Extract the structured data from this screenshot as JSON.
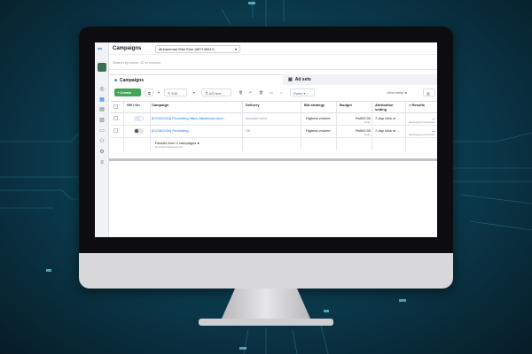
{
  "header": {
    "title": "Campaigns",
    "account": "Muhammad Bilal Sher (587145513...",
    "search_placeholder": "Search by name, ID or metrics"
  },
  "tabs": [
    {
      "label": "Campaigns",
      "icon": "folder-icon"
    },
    {
      "label": "Ad sets",
      "icon": "grid-icon"
    }
  ],
  "toolbar": {
    "create_label": "+ Create",
    "edit_label": "Edit",
    "abtest_label": "A/B test",
    "rules_label": "Rules",
    "view_setup_label": "View setup"
  },
  "table": {
    "columns": [
      "Off / On",
      "Campaign",
      "Delivery",
      "Bid strategy",
      "Budget",
      "Attribution setting",
      "Results"
    ],
    "rows": [
      {
        "state": "on",
        "campaign": "[07/02/2024] Promoting https://facebook.com/...",
        "delivery": "Account error",
        "bid": "Highest volume",
        "budget": "Rs500.00",
        "budget_sub": "Daily",
        "attribution": "7-day click or ...",
        "results": "—",
        "results_sub": "Messaging Conversat..."
      },
      {
        "state": "off",
        "campaign": "[07/06/2024] Promoting",
        "delivery": "Off",
        "bid": "Highest volume",
        "budget": "Rs500.00",
        "budget_sub": "Daily",
        "attribution": "7-day click or ...",
        "results": "—",
        "results_sub": "Messaging Conversat..."
      }
    ],
    "summary": "Results from 2 campaigns",
    "summary_sub": "Excludes deleted items"
  },
  "colors": {
    "accent": "#1877f2",
    "create": "#42a55a"
  }
}
